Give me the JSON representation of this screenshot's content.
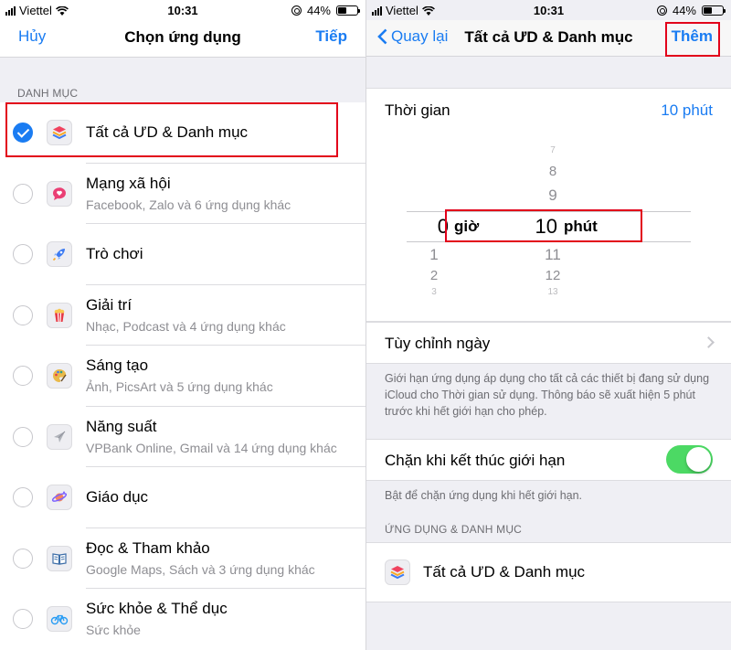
{
  "left": {
    "status": {
      "carrier": "Viettel",
      "time": "10:31",
      "battery": "44%",
      "battery_level": 0.44
    },
    "nav": {
      "cancel": "Hủy",
      "title": "Chọn ứng dụng",
      "next": "Tiếp"
    },
    "section_header": "DANH MỤC",
    "rows": [
      {
        "name": "Tất cả ƯD & Danh mục",
        "sub": "",
        "icon": "stack-layers-icon",
        "selected": true
      },
      {
        "name": "Mạng xã hội",
        "sub": "Facebook, Zalo và 6 ứng dụng khác",
        "icon": "chat-bubble-heart-icon",
        "selected": false
      },
      {
        "name": "Trò chơi",
        "sub": "",
        "icon": "rocket-icon",
        "selected": false
      },
      {
        "name": "Giải trí",
        "sub": "Nhạc, Podcast và 4 ứng dụng khác",
        "icon": "popcorn-icon",
        "selected": false
      },
      {
        "name": "Sáng tạo",
        "sub": "Ảnh, PicsArt và 5 ứng dụng khác",
        "icon": "palette-icon",
        "selected": false
      },
      {
        "name": "Năng suất",
        "sub": "VPBank Online, Gmail và 14 ứng dụng khác",
        "icon": "paper-plane-icon",
        "selected": false
      },
      {
        "name": "Giáo dục",
        "sub": "",
        "icon": "planet-icon",
        "selected": false
      },
      {
        "name": "Đọc & Tham khảo",
        "sub": "Google Maps, Sách và 3 ứng dụng khác",
        "icon": "book-icon",
        "selected": false
      },
      {
        "name": "Sức khỏe & Thể dục",
        "sub": "Sức khỏe",
        "icon": "bicycle-icon",
        "selected": false
      }
    ]
  },
  "right": {
    "status": {
      "carrier": "Viettel",
      "time": "10:31",
      "battery": "44%",
      "battery_level": 0.44
    },
    "nav": {
      "back": "Quay lại",
      "title": "Tất cả ƯD & Danh mục",
      "add": "Thêm"
    },
    "time_label": "Thời gian",
    "time_value": "10 phút",
    "picker": {
      "hours": {
        "above": [
          "",
          "",
          ""
        ],
        "selected": "0",
        "unit": "giờ",
        "below": [
          "1",
          "2",
          "3"
        ]
      },
      "minutes": {
        "above": [
          "7",
          "8",
          "9"
        ],
        "selected": "10",
        "unit": "phút",
        "below": [
          "11",
          "12",
          "13"
        ]
      }
    },
    "custom_days": "Tùy chỉnh ngày",
    "limit_note": "Giới hạn ứng dụng áp dụng cho tất cả các thiết bị đang sử dụng iCloud cho Thời gian sử dụng. Thông báo sẽ xuất hiện 5 phút trước khi hết giới hạn cho phép.",
    "block_label": "Chặn khi kết thúc giới hạn",
    "block_enabled": true,
    "block_note": "Bật để chặn ứng dụng khi hết giới hạn.",
    "apps_section": "ỨNG DỤNG & DANH MỤC",
    "apps_item": "Tất cả ƯD & Danh mục",
    "colors": {
      "accent": "#1a7cf2",
      "toggle_on": "#4cd964",
      "highlight": "#e2001a"
    }
  }
}
